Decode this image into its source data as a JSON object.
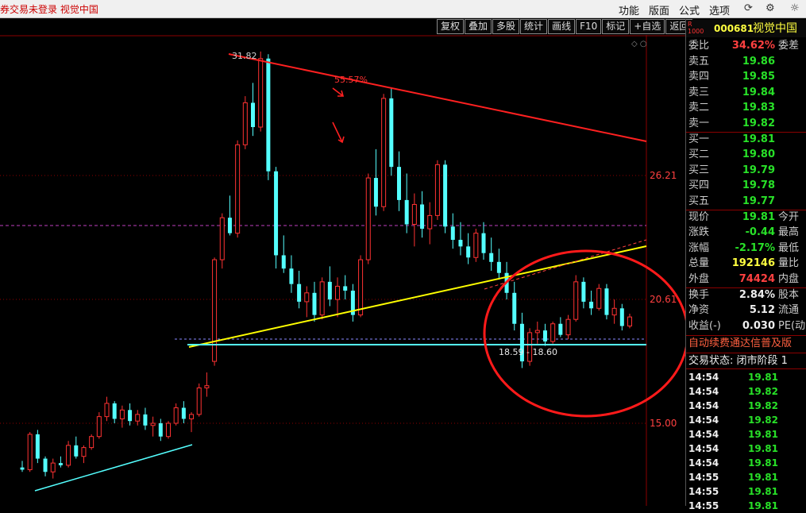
{
  "app": {
    "title": "券交易未登录  视觉中国",
    "menus": [
      "功能",
      "版面",
      "公式",
      "选项"
    ],
    "top_icons": [
      "refresh-icon",
      "settings-icon",
      "bell-icon"
    ]
  },
  "toolbar": [
    "复权",
    "叠加",
    "多股",
    "统计",
    "画线",
    "F10",
    "标记",
    "+自选",
    "返回"
  ],
  "chart": {
    "y_labels": [
      "26.21",
      "20.61",
      "15.00"
    ],
    "annotations": {
      "high": "31.82",
      "pct": "55.57%",
      "range": "18.59 - 18.60"
    },
    "colors": {
      "up": "#ff3232",
      "down": "#54ffff",
      "resistance": "#ff2020",
      "support": "#ffff00",
      "base": "#54ffff"
    }
  },
  "chart_data": {
    "type": "candlestick",
    "title": "",
    "y_ticks": [
      26.21,
      20.61,
      15.0
    ],
    "annotations": [
      "31.82",
      "55.57%",
      "18.59 - 18.60"
    ],
    "grid": true,
    "series": [
      {
        "values": [
          [
            13.0,
            13.3,
            12.8,
            12.9
          ],
          [
            12.9,
            14.6,
            12.8,
            14.5
          ],
          [
            14.5,
            14.7,
            13.2,
            13.4
          ],
          [
            13.4,
            13.5,
            12.6,
            12.8
          ],
          [
            12.8,
            13.4,
            12.5,
            13.2
          ]
        ]
      },
      {
        "values": [
          [
            13.2,
            13.5,
            13.0,
            13.1
          ],
          [
            13.1,
            14.2,
            13.0,
            14.0
          ],
          [
            14.0,
            14.4,
            13.4,
            13.5
          ],
          [
            13.5,
            14.0,
            13.2,
            13.9
          ],
          [
            13.9,
            14.5,
            13.8,
            14.4
          ]
        ]
      },
      {
        "values": [
          [
            14.4,
            15.5,
            14.3,
            15.3
          ],
          [
            15.3,
            16.2,
            15.1,
            15.9
          ],
          [
            15.9,
            16.0,
            15.0,
            15.2
          ],
          [
            15.2,
            15.8,
            14.8,
            15.6
          ],
          [
            15.6,
            15.9,
            14.9,
            15.1
          ]
        ]
      },
      {
        "values": [
          [
            15.1,
            15.6,
            14.9,
            15.4
          ],
          [
            15.4,
            15.7,
            14.7,
            14.9
          ],
          [
            14.9,
            15.3,
            14.4,
            15.0
          ],
          [
            15.0,
            15.2,
            14.2,
            14.4
          ],
          [
            14.4,
            15.1,
            14.3,
            15.0
          ]
        ]
      },
      {
        "values": [
          [
            15.0,
            15.9,
            14.9,
            15.7
          ],
          [
            15.7,
            16.0,
            15.0,
            15.2
          ],
          [
            15.2,
            15.5,
            14.6,
            15.4
          ],
          [
            15.4,
            16.8,
            15.3,
            16.6
          ],
          [
            16.6,
            17.3,
            16.2,
            16.7
          ]
        ]
      },
      {
        "values": [
          [
            17.8,
            22.5,
            17.6,
            22.4
          ],
          [
            22.4,
            24.5,
            22.0,
            24.3
          ],
          [
            24.3,
            25.3,
            23.5,
            23.6
          ],
          [
            23.6,
            27.8,
            23.4,
            27.6
          ],
          [
            27.6,
            29.8,
            27.4,
            29.5
          ]
        ]
      },
      {
        "values": [
          [
            29.5,
            30.4,
            28.0,
            28.4
          ],
          [
            28.4,
            31.82,
            28.2,
            31.5
          ],
          [
            31.5,
            31.7,
            26.0,
            26.4
          ],
          [
            26.4,
            26.6,
            22.0,
            22.6
          ],
          [
            22.6,
            23.5,
            21.8,
            22.0
          ]
        ]
      },
      {
        "values": [
          [
            22.0,
            22.6,
            20.9,
            21.3
          ],
          [
            21.3,
            21.9,
            20.2,
            20.5
          ],
          [
            20.5,
            21.2,
            19.8,
            20.9
          ],
          [
            20.9,
            21.4,
            19.6,
            19.9
          ],
          [
            19.9,
            21.6,
            19.7,
            21.4
          ]
        ]
      },
      {
        "values": [
          [
            21.4,
            22.1,
            20.3,
            20.6
          ],
          [
            20.6,
            21.6,
            19.8,
            21.2
          ],
          [
            21.2,
            21.7,
            20.6,
            21.0
          ],
          [
            21.0,
            21.3,
            19.6,
            19.9
          ],
          [
            19.9,
            22.6,
            19.8,
            22.4
          ]
        ]
      },
      {
        "values": [
          [
            22.4,
            26.3,
            22.2,
            26.1
          ],
          [
            26.1,
            27.4,
            24.4,
            24.8
          ],
          [
            24.8,
            29.9,
            24.6,
            29.7
          ],
          [
            29.7,
            30.2,
            26.2,
            26.6
          ],
          [
            26.6,
            27.3,
            24.6,
            25.1
          ]
        ]
      },
      {
        "values": [
          [
            25.1,
            26.3,
            23.6,
            24.0
          ],
          [
            24.0,
            25.4,
            23.0,
            24.9
          ],
          [
            24.9,
            25.5,
            23.4,
            23.8
          ],
          [
            23.8,
            25.0,
            23.1,
            24.4
          ],
          [
            24.4,
            26.9,
            24.2,
            26.7
          ]
        ]
      },
      {
        "values": [
          [
            26.7,
            26.9,
            23.6,
            23.9
          ],
          [
            23.9,
            24.5,
            22.9,
            23.3
          ],
          [
            23.3,
            24.1,
            22.6,
            23.0
          ],
          [
            23.0,
            23.6,
            22.2,
            22.5
          ],
          [
            22.5,
            23.8,
            22.3,
            23.6
          ]
        ]
      },
      {
        "values": [
          [
            23.6,
            24.1,
            22.4,
            22.7
          ],
          [
            22.7,
            23.4,
            21.9,
            22.3
          ],
          [
            22.3,
            22.9,
            21.5,
            21.8
          ],
          [
            21.8,
            22.3,
            20.6,
            20.9
          ],
          [
            20.9,
            21.4,
            19.2,
            19.5
          ]
        ]
      },
      {
        "values": [
          [
            19.5,
            20.0,
            17.5,
            17.8
          ],
          [
            17.8,
            19.3,
            17.6,
            19.1
          ],
          [
            19.1,
            19.6,
            18.6,
            19.2
          ],
          [
            19.2,
            19.5,
            18.5,
            18.7
          ],
          [
            18.7,
            19.6,
            18.6,
            19.5
          ]
        ]
      },
      {
        "values": [
          [
            19.5,
            19.8,
            18.9,
            19.0
          ],
          [
            19.0,
            19.9,
            18.8,
            19.7
          ],
          [
            19.7,
            21.7,
            19.6,
            21.4
          ],
          [
            21.4,
            21.6,
            20.2,
            20.5
          ],
          [
            20.5,
            21.0,
            19.9,
            20.2
          ]
        ]
      },
      {
        "values": [
          [
            20.2,
            21.3,
            20.1,
            21.1
          ],
          [
            21.1,
            21.3,
            19.7,
            19.9
          ],
          [
            19.9,
            20.6,
            19.5,
            20.2
          ],
          [
            20.2,
            20.4,
            19.2,
            19.4
          ],
          [
            19.4,
            19.96,
            19.3,
            19.81
          ]
        ]
      }
    ]
  },
  "quote": {
    "code": "000681",
    "name": "视觉中国",
    "rows": [
      {
        "label": "委比",
        "value": "34.62%",
        "label2": "委差",
        "color": "red"
      },
      {
        "label": "卖五",
        "value": "19.86",
        "color": "green"
      },
      {
        "label": "卖四",
        "value": "19.85",
        "color": "green"
      },
      {
        "label": "卖三",
        "value": "19.84",
        "color": "green"
      },
      {
        "label": "卖二",
        "value": "19.83",
        "color": "green"
      },
      {
        "label": "卖一",
        "value": "19.82",
        "color": "green"
      },
      {
        "label": "买一",
        "value": "19.81",
        "color": "green"
      },
      {
        "label": "买二",
        "value": "19.80",
        "color": "green"
      },
      {
        "label": "买三",
        "value": "19.79",
        "color": "green"
      },
      {
        "label": "买四",
        "value": "19.78",
        "color": "green"
      },
      {
        "label": "买五",
        "value": "19.77",
        "color": "green"
      },
      {
        "label": "现价",
        "value": "19.81",
        "label2": "今开",
        "color": "green"
      },
      {
        "label": "涨跌",
        "value": "-0.44",
        "label2": "最高",
        "color": "green"
      },
      {
        "label": "涨幅",
        "value": "-2.17%",
        "label2": "最低",
        "color": "green"
      },
      {
        "label": "总量",
        "value": "192146",
        "label2": "量比",
        "color": "yellow"
      },
      {
        "label": "外盘",
        "value": "74424",
        "label2": "内盘",
        "color": "red"
      },
      {
        "label": "换手",
        "value": "2.84%",
        "label2": "股本",
        "color": "white"
      },
      {
        "label": "净资",
        "value": "5.12",
        "label2": "流通",
        "color": "white"
      },
      {
        "label": "收益(-)",
        "value": "0.030",
        "label2": "PE(动",
        "color": "white"
      }
    ],
    "news": "自动续费通达信普及版",
    "status": "交易状态: 闭市阶段 1",
    "ticks": [
      {
        "time": "14:54",
        "price": "19.81"
      },
      {
        "time": "14:54",
        "price": "19.82"
      },
      {
        "time": "14:54",
        "price": "19.82"
      },
      {
        "time": "14:54",
        "price": "19.82"
      },
      {
        "time": "14:54",
        "price": "19.81"
      },
      {
        "time": "14:54",
        "price": "19.81"
      },
      {
        "time": "14:54",
        "price": "19.81"
      },
      {
        "time": "14:55",
        "price": "19.81"
      },
      {
        "time": "14:55",
        "price": "19.81"
      },
      {
        "time": "14:55",
        "price": "19.81"
      }
    ]
  }
}
